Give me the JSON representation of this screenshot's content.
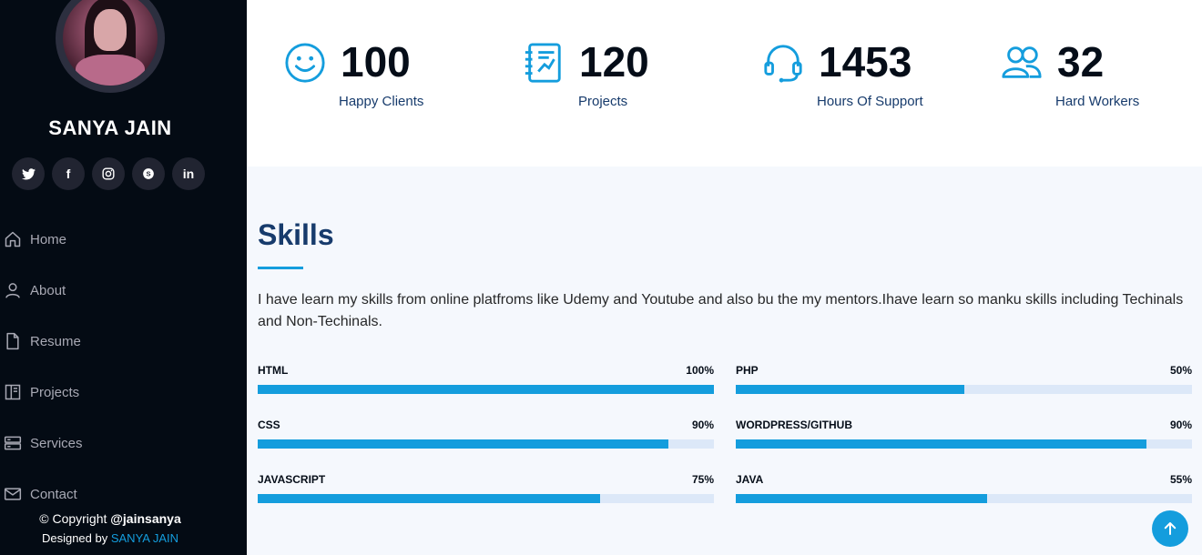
{
  "profile": {
    "name": "SANYA JAIN"
  },
  "social": [
    {
      "icon": "twitter-icon",
      "glyph": "𝕥"
    },
    {
      "icon": "facebook-icon",
      "glyph": "f"
    },
    {
      "icon": "instagram-icon",
      "glyph": "◎"
    },
    {
      "icon": "skype-icon",
      "glyph": "S"
    },
    {
      "icon": "linkedin-icon",
      "glyph": "in"
    }
  ],
  "nav": [
    {
      "label": "Home",
      "icon": "home-icon"
    },
    {
      "label": "About",
      "icon": "person-icon"
    },
    {
      "label": "Resume",
      "icon": "file-icon"
    },
    {
      "label": "Projects",
      "icon": "book-icon"
    },
    {
      "label": "Services",
      "icon": "server-icon"
    },
    {
      "label": "Contact",
      "icon": "envelope-icon"
    }
  ],
  "footer": {
    "copyright_prefix": "© Copyright ",
    "copyright_handle": "@jainsanya",
    "designed_prefix": "Designed by ",
    "designed_name": "SANYA JAIN"
  },
  "stats": [
    {
      "value": "100",
      "label": "Happy Clients",
      "icon": "smile-icon"
    },
    {
      "value": "120",
      "label": "Projects",
      "icon": "journal-icon"
    },
    {
      "value": "1453",
      "label": "Hours Of Support",
      "icon": "headset-icon"
    },
    {
      "value": "32",
      "label": "Hard Workers",
      "icon": "people-icon"
    }
  ],
  "skills": {
    "title": "Skills",
    "description": "I have learn my skills from online platfroms like Udemy and Youtube and also bu the my mentors.Ihave learn so manku skills including Techinals and Non-Techinals.",
    "items": [
      {
        "name": "HTML",
        "percent_label": "100%",
        "percent": 100
      },
      {
        "name": "PHP",
        "percent_label": "50%",
        "percent": 50
      },
      {
        "name": "CSS",
        "percent_label": "90%",
        "percent": 90
      },
      {
        "name": "WORDPRESS/GITHUB",
        "percent_label": "90%",
        "percent": 90
      },
      {
        "name": "JAVASCRIPT",
        "percent_label": "75%",
        "percent": 75
      },
      {
        "name": "JAVA",
        "percent_label": "55%",
        "percent": 55
      }
    ]
  },
  "colors": {
    "accent": "#149ddd",
    "sidebar_bg": "#040b14",
    "heading": "#173b6c"
  }
}
